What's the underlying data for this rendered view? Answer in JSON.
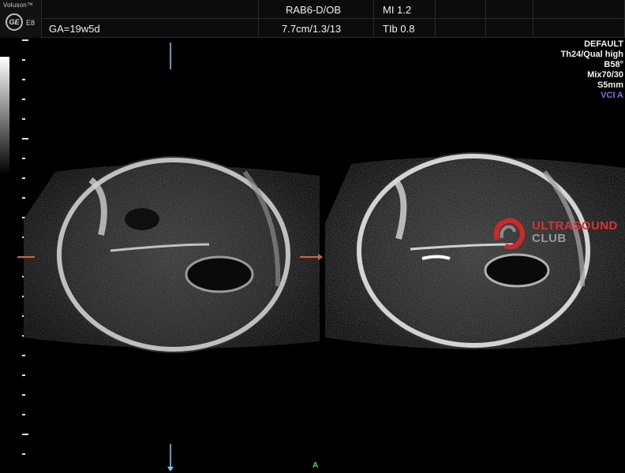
{
  "header": {
    "brand": "Voluson™",
    "logo_text": "GE",
    "model": "E8",
    "probe_preset": "RAB6-D/OB",
    "mechanical_index": "MI  1.2",
    "gestational_age": "GA=19w5d",
    "depth_settings": "7.7cm/1.3/13",
    "thermal_index": "TIb  0.8"
  },
  "parameters": {
    "lines": [
      "DEFAULT",
      "Th24/Qual high",
      "B58°",
      "Mix70/30",
      "S5mm"
    ],
    "vci": "VCI A"
  },
  "watermark": {
    "line1": "ULTRASOUND",
    "line2": "CLUB"
  },
  "frame_label": "A",
  "colors": {
    "background": "#000000",
    "header": "#0c0c0c",
    "vci_text": "#6b74ff",
    "watermark_red": "#e03030",
    "marker_orange": "#e0602a",
    "marker_cyan": "#6ad0ff"
  }
}
